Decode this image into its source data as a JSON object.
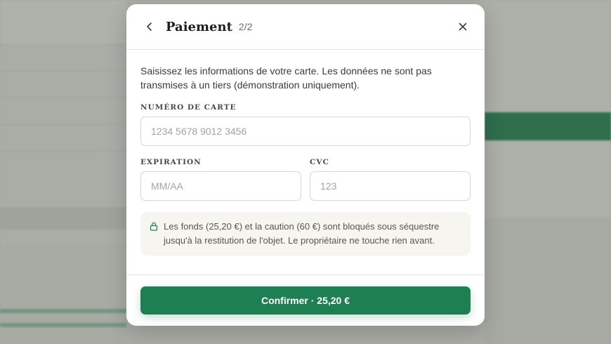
{
  "modal": {
    "title": "Paiement",
    "step": "2/2",
    "back_icon": "chevron-left-icon",
    "close_icon": "close-icon",
    "intro": "Saisissez les informations de votre carte. Les données ne sont pas transmises à un tiers (démonstration uniquement).",
    "card_number": {
      "label": "Numéro de carte",
      "placeholder": "1234 5678 9012 3456",
      "value": ""
    },
    "expiration": {
      "label": "Expiration",
      "placeholder": "MM/AA",
      "value": ""
    },
    "cvc": {
      "label": "CVC",
      "placeholder": "123",
      "value": ""
    },
    "notice": {
      "icon": "lock-icon",
      "text": "Les fonds (25,20 €) et la caution (60 €) sont bloqués sous séquestre jusqu'à la restitution de l'objet. Le propriétaire ne touche rien avant."
    },
    "confirm_label": "Confirmer · 25,20 €"
  },
  "colors": {
    "accent": "#1e8052",
    "notice_bg": "#f7f5ef",
    "overlay": "#b4b8b1"
  }
}
